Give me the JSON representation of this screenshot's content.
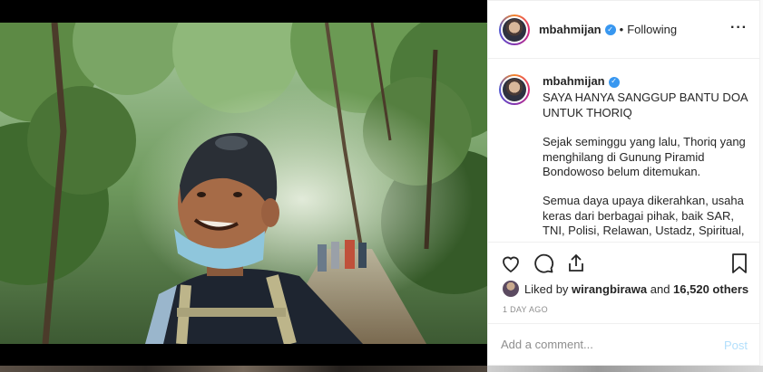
{
  "post": {
    "username": "mbahmijan",
    "verified_icon": "verified-badge-icon",
    "separator": "•",
    "follow_status": "Following",
    "more_icon": "more-options-icon"
  },
  "caption": {
    "username": "mbahmijan",
    "paragraphs": [
      "SAYA HANYA SANGGUP BANTU DOA UNTUK THORIQ",
      "Sejak seminggu yang lalu, Thoriq yang menghilang di Gunung Piramid Bondowoso belum ditemukan.",
      "Semua daya upaya dikerahkan, usaha keras dari berbagai pihak, baik SAR, TNI, Polisi, Relawan, Ustadz, Spiritual,"
    ]
  },
  "actions": {
    "like_icon": "heart-icon",
    "comment_icon": "comment-icon",
    "share_icon": "share-icon",
    "save_icon": "bookmark-icon"
  },
  "likes": {
    "prefix": "Liked by ",
    "liker": "wirangbirawa",
    "middle": " and ",
    "count": "16,520 others"
  },
  "timestamp": "1 DAY AGO",
  "comment": {
    "placeholder": "Add a comment...",
    "post_label": "Post"
  },
  "colors": {
    "verified": "#3897f0",
    "post_button": "#b2dffc",
    "muted": "#8e8e8e"
  }
}
